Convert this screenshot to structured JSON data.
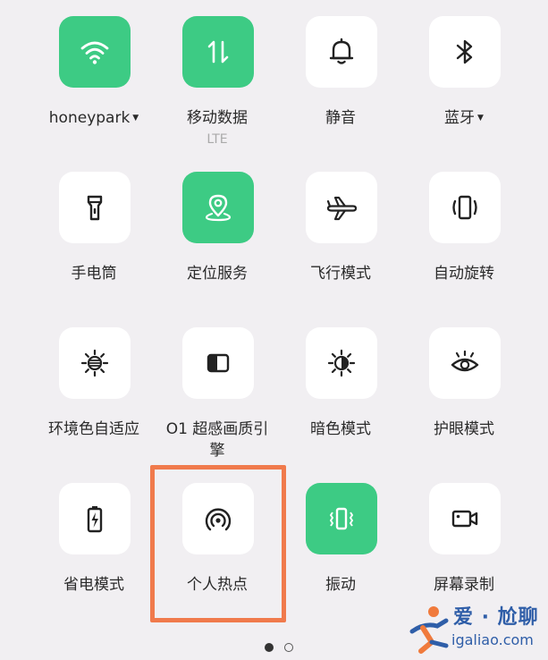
{
  "tiles": [
    {
      "label": "honeypark",
      "dropdown": true,
      "icon": "wifi-icon",
      "active": true
    },
    {
      "label": "移动数据",
      "sublabel": "LTE",
      "icon": "mobile-data-icon",
      "active": true
    },
    {
      "label": "静音",
      "icon": "bell-icon",
      "active": false
    },
    {
      "label": "蓝牙",
      "dropdown": true,
      "icon": "bluetooth-icon",
      "active": false
    },
    {
      "label": "手电筒",
      "icon": "flashlight-icon",
      "active": false
    },
    {
      "label": "定位服务",
      "icon": "location-icon",
      "active": true
    },
    {
      "label": "飞行模式",
      "icon": "airplane-icon",
      "active": false
    },
    {
      "label": "自动旋转",
      "icon": "rotate-icon",
      "active": false
    },
    {
      "label": "环境色自适应",
      "icon": "ambient-color-icon",
      "active": false
    },
    {
      "label": "O1 超感画质引",
      "label2": "擎",
      "icon": "display-engine-icon",
      "active": false
    },
    {
      "label": "暗色模式",
      "icon": "dark-mode-icon",
      "active": false
    },
    {
      "label": "护眼模式",
      "icon": "eye-icon",
      "active": false
    },
    {
      "label": "省电模式",
      "icon": "battery-saver-icon",
      "active": false
    },
    {
      "label": "个人热点",
      "icon": "hotspot-icon",
      "active": false,
      "highlighted": true
    },
    {
      "label": "振动",
      "icon": "vibrate-icon",
      "active": true
    },
    {
      "label": "屏幕录制",
      "icon": "screen-record-icon",
      "active": false
    }
  ],
  "pagination": {
    "pages": 2,
    "current": 1
  },
  "watermark": {
    "title": "爱 · 尬聊",
    "url": "igaliao.com"
  },
  "colors": {
    "active_tile": "#3dcb84",
    "inactive_tile": "#ffffff",
    "background": "#f1eff2",
    "highlight_box": "#f07a4c"
  }
}
